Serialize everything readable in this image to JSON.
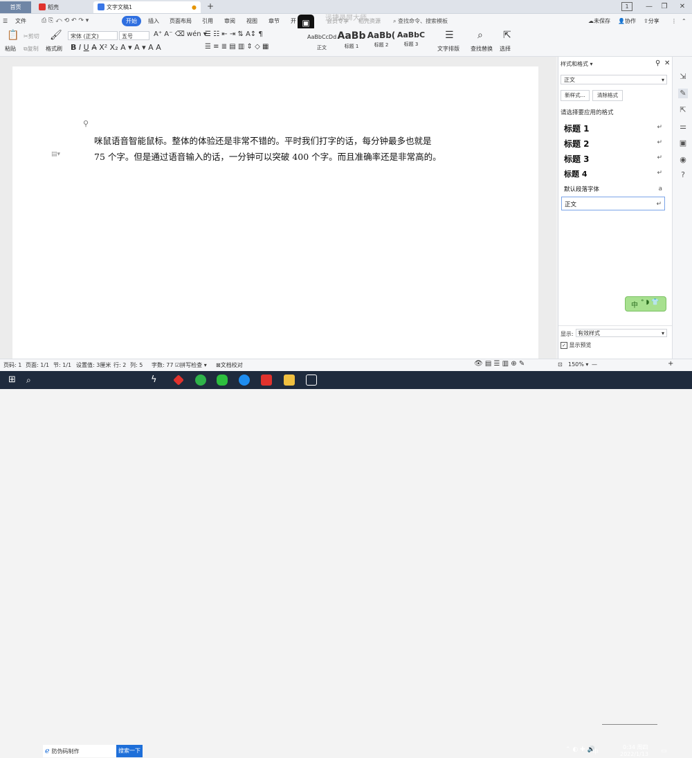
{
  "tabs": [
    {
      "label": "首页"
    },
    {
      "label": "稻壳"
    },
    {
      "label": "文字文稿1"
    }
  ],
  "window": {
    "new_tab": "+",
    "page_badge": "1",
    "min": "—",
    "max": "❐",
    "close": "✕"
  },
  "menu": {
    "file": "文件",
    "items": [
      "开始",
      "插入",
      "页面布局",
      "引用",
      "审阅",
      "视图",
      "章节",
      "开",
      "会员专享",
      "稻壳资源"
    ],
    "search_placeholder": "查找命令、搜索模板",
    "unsaved": "未保存",
    "collab": "协作",
    "share": "分享",
    "watermark": "迅捷录屏大师"
  },
  "ribbon": {
    "paste": "粘贴",
    "cut": "剪切",
    "copy": "复制",
    "format_painter": "格式刷",
    "font_name": "宋体 (正文)",
    "font_size": "五号",
    "styles": [
      {
        "sample": "AaBbCcDd",
        "label": "正文"
      },
      {
        "sample": "AaBb",
        "label": "标题 1"
      },
      {
        "sample": "AaBb(",
        "label": "标题 2"
      },
      {
        "sample": "AaBbC",
        "label": "标题 3"
      }
    ],
    "text_layout": "文字排版",
    "find_replace": "查找替换",
    "select": "选择"
  },
  "document": {
    "line1": "咪鼠语音智能鼠标。整体的体验还是非常不错的。平时我们打字的话，每分钟最多也就是",
    "line2": "75 个字。但是通过语音输入的话，一分钟可以突破 400 个字。而且准确率还是非常高的。"
  },
  "panel": {
    "title": "样式和格式",
    "current_style": "正文",
    "new_style": "新样式...",
    "clear_format": "清除格式",
    "apply_prompt": "请选择要应用的格式",
    "styles": [
      {
        "name": "标题  1",
        "mark": "↵"
      },
      {
        "name": "标题  2",
        "mark": "↵"
      },
      {
        "name": "标题  3",
        "mark": "↵"
      },
      {
        "name": "标题  4",
        "mark": "↵"
      },
      {
        "name": "默认段落字体",
        "mark": "a"
      },
      {
        "name": "正文",
        "mark": "↵"
      }
    ],
    "show_label": "显示:",
    "show_value": "有效样式",
    "preview": "显示预览"
  },
  "ime": {
    "label": "中"
  },
  "status": {
    "page_num": "页码: 1",
    "pages": "页面: 1/1",
    "section": "节: 1/1",
    "setting": "设置值: 3厘米",
    "row": "行: 2",
    "col": "列: 5",
    "words": "字数: 77",
    "spell": "拼写检查",
    "proof": "文档校对",
    "zoom": "150%",
    "zoom_out": "—",
    "zoom_in": "+"
  },
  "taskbar": {
    "search_text": "防伪码制作",
    "search_button": "搜索一下",
    "lang": "中",
    "time": "0:34 周四",
    "date": "2022/1/13"
  },
  "colors": {
    "accent": "#2f6fe0",
    "home_tab": "#6f86a6",
    "taskbar": "#1f2b3d",
    "wps_red": "#e0322d"
  }
}
